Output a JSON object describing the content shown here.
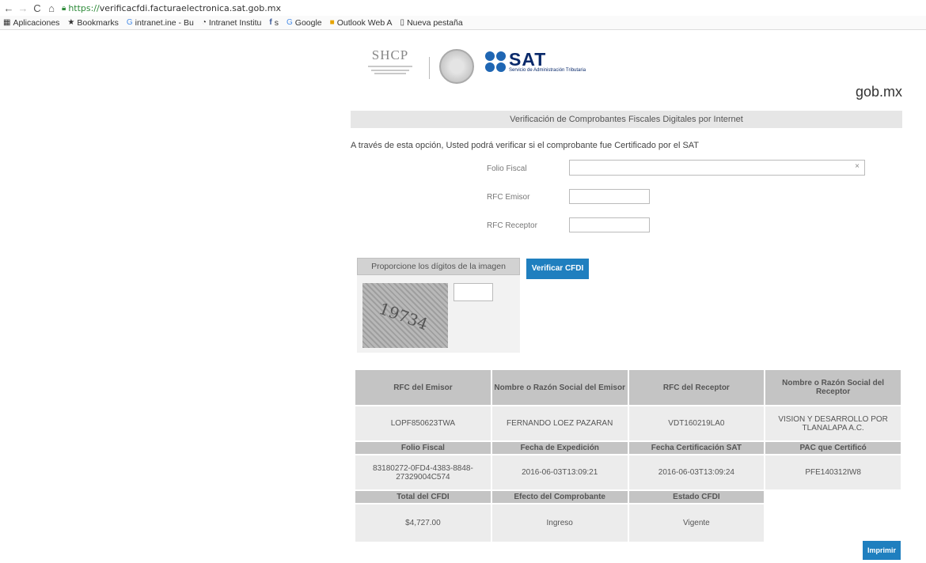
{
  "browser": {
    "url_scheme": "https://",
    "url_host": "verificacfdi.facturaelectronica.sat.gob.mx",
    "bookmarks": [
      "Aplicaciones",
      "Bookmarks",
      "intranet.ine - Bu",
      "Intranet Institu",
      "s",
      "Google",
      "Outlook Web A",
      "Nueva pestaña"
    ]
  },
  "header": {
    "shcp_logo": "SHCP",
    "sat_logo": "SAT",
    "sat_subtitle": "Servicio de Administración Tributaria",
    "gob": "gob.mx"
  },
  "page": {
    "title": "Verificación de Comprobantes Fiscales Digitales por Internet",
    "intro": "A través de esta opción, Usted podrá verificar si el comprobante fue Certificado por el SAT"
  },
  "form": {
    "folio_label": "Folio Fiscal",
    "clear_icon": "×",
    "rfc_emisor_label": "RFC Emisor",
    "rfc_receptor_label": "RFC Receptor",
    "captcha_label": "Proporcione los dígitos de la imagen",
    "captcha_text": "19734",
    "verify_button": "Verificar CFDI"
  },
  "results": {
    "headers_1": [
      "RFC del Emisor",
      "Nombre o Razón Social del Emisor",
      "RFC del Receptor",
      "Nombre o Razón Social del Receptor"
    ],
    "values_1": [
      "LOPF850623TWA",
      "FERNANDO LOEZ PAZARAN",
      "VDT160219LA0",
      "VISION Y DESARROLLO POR TLANALAPA A.C."
    ],
    "headers_2": [
      "Folio Fiscal",
      "Fecha de Expedición",
      "Fecha Certificación SAT",
      "PAC que Certificó"
    ],
    "values_2": [
      "83180272-0FD4-4383-8848-27329004C574",
      "2016-06-03T13:09:21",
      "2016-06-03T13:09:24",
      "PFE140312IW8"
    ],
    "headers_3": [
      "Total del CFDI",
      "Efecto del Comprobante",
      "Estado CFDI"
    ],
    "values_3": [
      "$4,727.00",
      "Ingreso",
      "Vigente"
    ]
  },
  "print_button": "Imprimir"
}
